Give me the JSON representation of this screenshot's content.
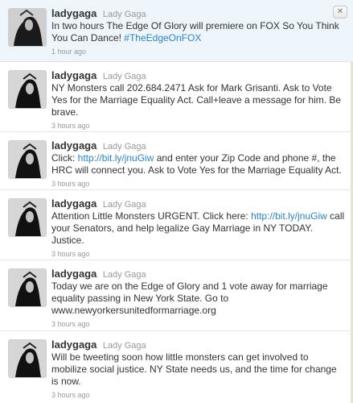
{
  "tweets": [
    {
      "screen_name": "ladygaga",
      "full_name": "Lady Gaga",
      "text_before": "In two hours The Edge Of Glory will premiere on FOX So You Think You Can Dance! ",
      "link": "#TheEdgeOnFOX",
      "text_after": "",
      "time": "1 hour ago"
    },
    {
      "screen_name": "ladygaga",
      "full_name": "Lady Gaga",
      "text_before": "NY Monsters call 202.684.2471 Ask for Mark Grisanti. Ask to Vote Yes for the Marriage Equality Act. Call+leave a message for him. Be brave.",
      "link": "",
      "text_after": "",
      "time": "3 hours ago"
    },
    {
      "screen_name": "ladygaga",
      "full_name": "Lady Gaga",
      "text_before": "Click: ",
      "link": "http://bit.ly/jnuGiw",
      "text_after": " and enter your Zip Code and phone #, the HRC will connect you. Ask to Vote Yes for the Marriage Equality Act.",
      "time": "3 hours ago"
    },
    {
      "screen_name": "ladygaga",
      "full_name": "Lady Gaga",
      "text_before": "Attention Little Monsters URGENT. Click here: ",
      "link": "http://bit.ly/jnuGiw",
      "text_after": " call your Senators, and help legalize Gay Marriage in NY TODAY. Justice.",
      "time": "3 hours ago"
    },
    {
      "screen_name": "ladygaga",
      "full_name": "Lady Gaga",
      "text_before": "Today we are on the Edge of Glory and 1 vote away for marriage equality passing in New York State. Go to www.newyorkersunitedformarriage.org",
      "link": "",
      "text_after": "",
      "time": "3 hours ago"
    },
    {
      "screen_name": "ladygaga",
      "full_name": "Lady Gaga",
      "text_before": "Will be tweeting soon how little monsters can get involved to mobilize social justice. NY State needs us, and the time for change is now.",
      "link": "",
      "text_after": "",
      "time": "3 hours ago"
    }
  ],
  "dismiss_icon": "x-icon"
}
